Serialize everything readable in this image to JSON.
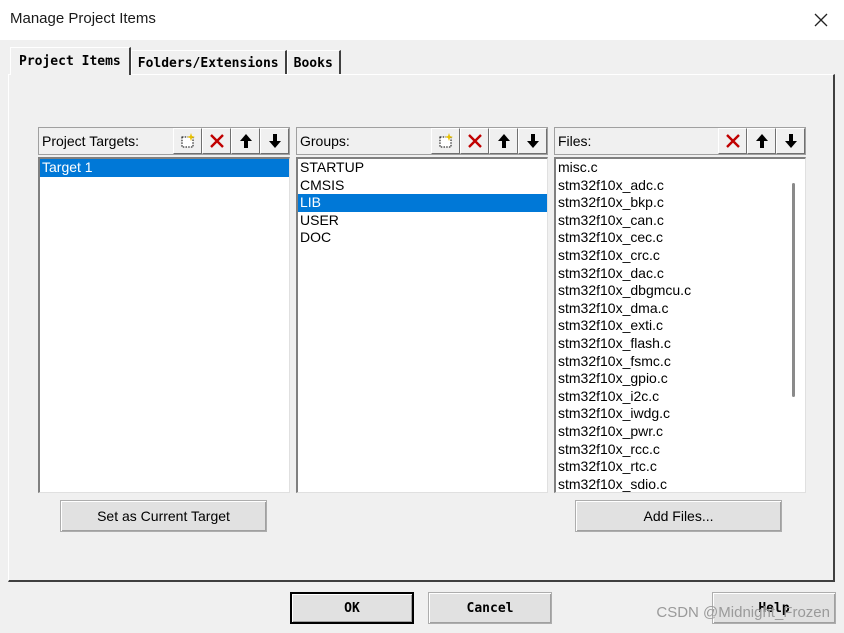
{
  "window": {
    "title": "Manage Project Items"
  },
  "tabs": [
    {
      "label": "Project Items"
    },
    {
      "label": "Folders/Extensions"
    },
    {
      "label": "Books"
    }
  ],
  "targets": {
    "header": "Project Targets:",
    "items": [
      {
        "label": "Target 1",
        "selected": true
      }
    ],
    "set_current_label": "Set as Current Target"
  },
  "groups": {
    "header": "Groups:",
    "items": [
      {
        "label": "STARTUP",
        "selected": false
      },
      {
        "label": "CMSIS",
        "selected": false
      },
      {
        "label": "LIB",
        "selected": true
      },
      {
        "label": "USER",
        "selected": false
      },
      {
        "label": "DOC",
        "selected": false
      }
    ]
  },
  "files": {
    "header": "Files:",
    "items": [
      "misc.c",
      "stm32f10x_adc.c",
      "stm32f10x_bkp.c",
      "stm32f10x_can.c",
      "stm32f10x_cec.c",
      "stm32f10x_crc.c",
      "stm32f10x_dac.c",
      "stm32f10x_dbgmcu.c",
      "stm32f10x_dma.c",
      "stm32f10x_exti.c",
      "stm32f10x_flash.c",
      "stm32f10x_fsmc.c",
      "stm32f10x_gpio.c",
      "stm32f10x_i2c.c",
      "stm32f10x_iwdg.c",
      "stm32f10x_pwr.c",
      "stm32f10x_rcc.c",
      "stm32f10x_rtc.c",
      "stm32f10x_sdio.c"
    ],
    "add_files_label": "Add Files..."
  },
  "dialog_buttons": {
    "ok": "OK",
    "cancel": "Cancel",
    "help": "Help"
  },
  "watermark": "CSDN @Midnight_Frozen",
  "colors": {
    "selection": "#0078d7",
    "delete_red": "#c00000"
  }
}
